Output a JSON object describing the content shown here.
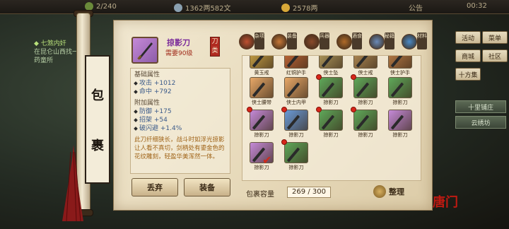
{
  "topbar": {
    "stamina": "2/240",
    "money": "1362两582文",
    "gold": "2578两",
    "notice": "公告",
    "time": "00:32"
  },
  "quest": {
    "title": "七煞内奸",
    "body": "在昆仑山西找一找药童所"
  },
  "right_menu": {
    "activity": "活动",
    "menu": "菜单",
    "mall": "商城",
    "community": "社区",
    "ten_dir": "十方集",
    "list_items": [
      "十里铺庄",
      "云绣坊"
    ]
  },
  "side_title": [
    "包",
    "裹"
  ],
  "item": {
    "name": "掠影刀",
    "requirement": "需要90级",
    "type_tag": "刀类",
    "base_header": "基础属性",
    "base": [
      {
        "k": "攻击",
        "v": "+1012"
      },
      {
        "k": "命中",
        "v": "+792"
      }
    ],
    "extra_header": "附加属性",
    "extra": [
      {
        "k": "防御",
        "v": "+175"
      },
      {
        "k": "招架",
        "v": "+54"
      },
      {
        "k": "破闪避",
        "v": "+1.4%"
      }
    ],
    "description": "此刀纤细狭长，战斗时如浮光掠影让人看不真切，剑柄处有鎏金色的花纹雕刻，轻盈华美浑然一体。"
  },
  "buttons": {
    "discard": "丢弃",
    "equip": "装备",
    "sort": "整理"
  },
  "tabs": [
    {
      "label": "杂项",
      "color": "#c05030"
    },
    {
      "label": "装备",
      "color": "#c87838"
    },
    {
      "label": "兵器",
      "color": "#8a4a2a"
    },
    {
      "label": "酒食",
      "color": "#b06a28"
    },
    {
      "label": "秘籍",
      "color": "#6a8ab8"
    },
    {
      "label": "材料",
      "color": "#4a8ac8"
    }
  ],
  "grid": {
    "rows": [
      [
        {
          "name": "黄玉戒",
          "c": "#d0a848"
        },
        {
          "name": "红铜护手",
          "c": "#c86a38"
        },
        {
          "name": "侠士坠",
          "c": "#b8a060"
        },
        {
          "name": "侠士戒",
          "c": "#b89058"
        },
        {
          "name": "侠士护手",
          "c": "#c08048"
        }
      ],
      [
        {
          "name": "侠士腰带",
          "c": "#e8a868"
        },
        {
          "name": "侠士内甲",
          "c": "#e8a868"
        },
        {
          "name": "掠影刀",
          "c": "#5fa85a",
          "dot": true
        },
        {
          "name": "掠影刀",
          "c": "#5fa85a",
          "dot": true
        },
        {
          "name": "掠影刀",
          "c": "#5fa85a"
        }
      ],
      [
        {
          "name": "掠影刀",
          "c": "#c58ad8",
          "dot": true
        },
        {
          "name": "掠影刀",
          "c": "#6a9ad8",
          "dot": true
        },
        {
          "name": "掠影刀",
          "c": "#5fa85a",
          "dot": true
        },
        {
          "name": "掠影刀",
          "c": "#5fa85a",
          "dot": true
        },
        {
          "name": "掠影刀",
          "c": "#c58ad8"
        }
      ],
      [
        {
          "name": "掠影刀",
          "c": "#c58ad8",
          "check": true
        },
        {
          "name": "掠影刀",
          "c": "#5fa85a",
          "dot": true
        }
      ]
    ]
  },
  "capacity": {
    "label": "包裹容量",
    "value": "269 / 300"
  },
  "logo": "唐门"
}
